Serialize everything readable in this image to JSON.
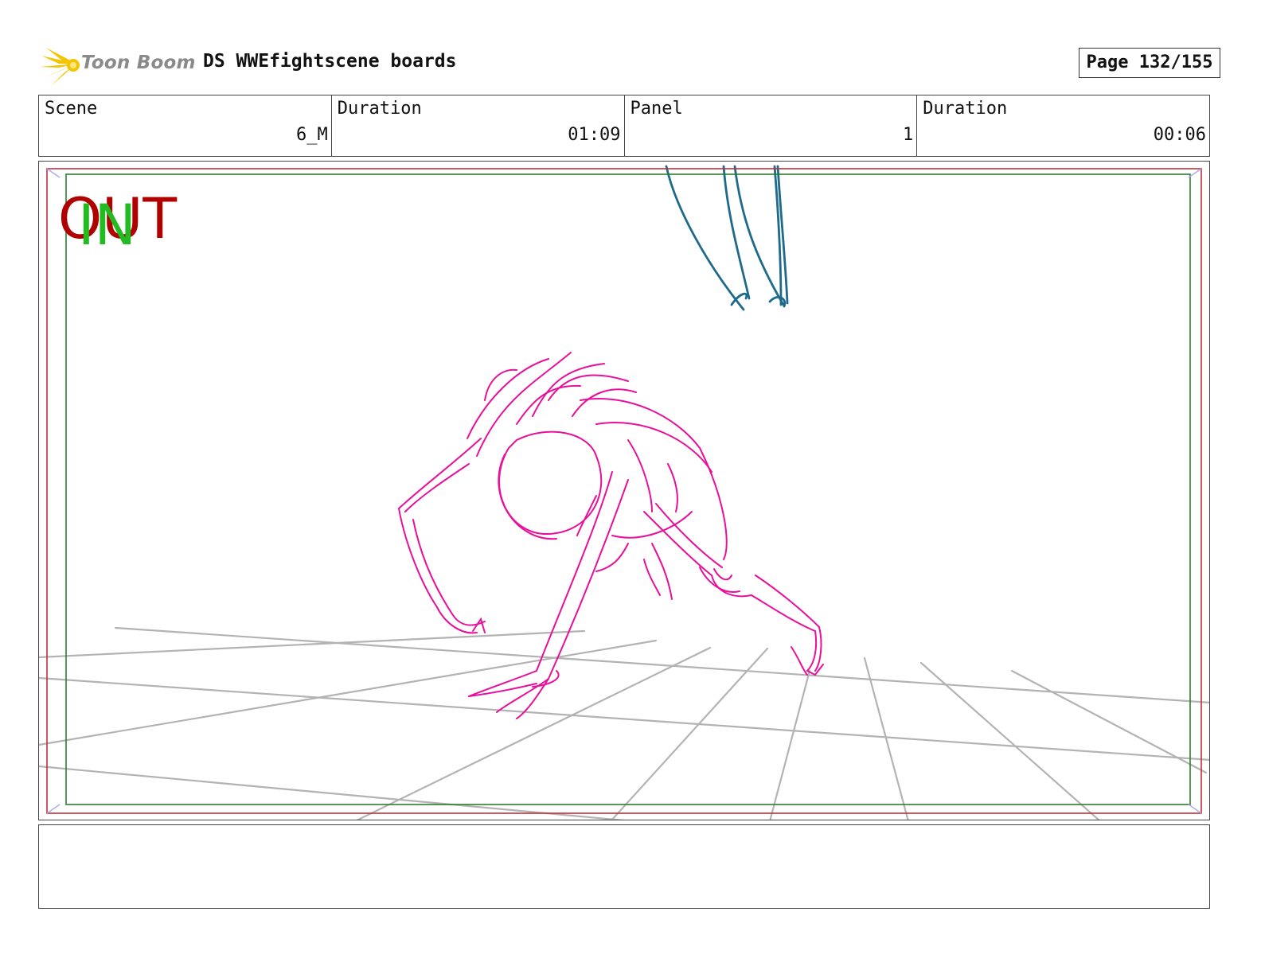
{
  "header": {
    "logo_text": "Toon Boom",
    "title": "DS WWEfightscene boards",
    "page": "Page 132/155"
  },
  "info": {
    "scene_label": "Scene",
    "scene_value": "6_M",
    "scene_duration_label": "Duration",
    "scene_duration_value": "01:09",
    "panel_label": "Panel",
    "panel_value": "1",
    "panel_duration_label": "Duration",
    "panel_duration_value": "00:06"
  },
  "panel": {
    "out_label": "OUT",
    "in_label": "IN"
  },
  "notes": {
    "text": ""
  },
  "colors": {
    "logo_star": "#f5c400",
    "logo_text": "#8a8a8a",
    "out_frame": "#c0303a",
    "in_frame": "#2e7d32",
    "out_label": "#b00000",
    "in_label": "#22bb22",
    "character_sketch": "#e8109a",
    "hands_sketch": "#1e6a8a",
    "floor_grid": "#b3b3b3"
  },
  "icons": {
    "logo": "toon-boom-star-icon"
  }
}
